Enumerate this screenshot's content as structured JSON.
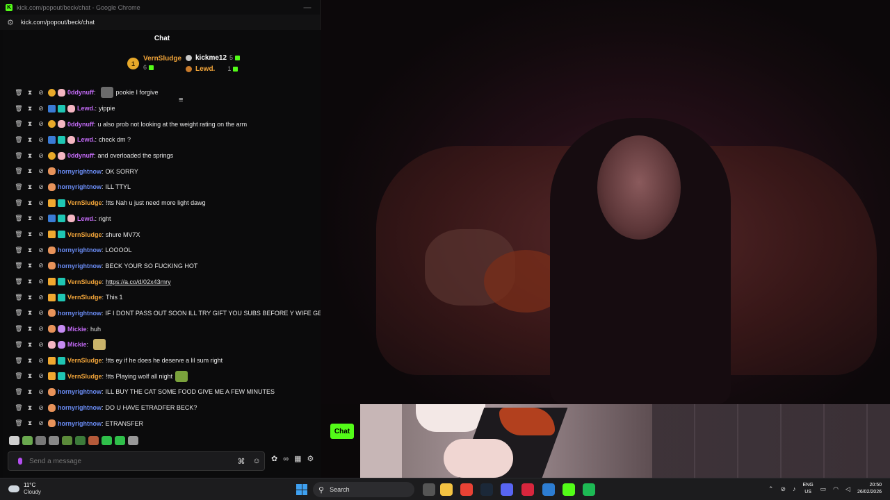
{
  "window": {
    "title": "kick.com/popout/beck/chat - Google Chrome",
    "url": "kick.com/popout/beck/chat",
    "favicon_letter": "K"
  },
  "chat": {
    "header": "Chat",
    "leaderboard": {
      "first": {
        "rank": "1",
        "name": "VernSludge",
        "count": "6"
      },
      "second": {
        "name": "kickme12",
        "count": "5"
      },
      "third": {
        "name": "Lewd.",
        "count": "1"
      }
    },
    "messages": [
      {
        "user": "0ddynuff",
        "color": "#c26af5",
        "badges": [
          "b-coin",
          "b-pig"
        ],
        "text": "pookie I forgive",
        "emote_before": "emote",
        "link": false
      },
      {
        "user": "Lewd.",
        "color": "#c26af5",
        "badges": [
          "b-blue",
          "b-teal",
          "b-pig"
        ],
        "text": "yippie",
        "link": false
      },
      {
        "user": "0ddynuff",
        "color": "#c26af5",
        "badges": [
          "b-coin",
          "b-pig"
        ],
        "text": "u also prob not looking at the weight rating on the arm",
        "link": false
      },
      {
        "user": "Lewd.",
        "color": "#c26af5",
        "badges": [
          "b-blue",
          "b-teal",
          "b-pig"
        ],
        "text": "check dm ?",
        "link": false
      },
      {
        "user": "0ddynuff",
        "color": "#c26af5",
        "badges": [
          "b-coin",
          "b-pig"
        ],
        "text": "and overloaded the springs",
        "link": false
      },
      {
        "user": "hornyrightnow",
        "color": "#6a8cf5",
        "badges": [
          "b-bear"
        ],
        "text": "OK SORRY",
        "link": false
      },
      {
        "user": "hornyrightnow",
        "color": "#6a8cf5",
        "badges": [
          "b-bear"
        ],
        "text": "ILL TTYL",
        "link": false
      },
      {
        "user": "VernSludge",
        "color": "#f2a53a",
        "badges": [
          "b-crown",
          "b-teal"
        ],
        "text": "!tts Nah u just need more light dawg",
        "link": false
      },
      {
        "user": "Lewd.",
        "color": "#c26af5",
        "badges": [
          "b-blue",
          "b-teal",
          "b-pig"
        ],
        "text": "right",
        "link": false
      },
      {
        "user": "VernSludge",
        "color": "#f2a53a",
        "badges": [
          "b-crown",
          "b-teal"
        ],
        "text": "shure MV7X",
        "link": false
      },
      {
        "user": "hornyrightnow",
        "color": "#6a8cf5",
        "badges": [
          "b-bear"
        ],
        "text": "LOOOOL",
        "link": false
      },
      {
        "user": "hornyrightnow",
        "color": "#6a8cf5",
        "badges": [
          "b-bear"
        ],
        "text": "BECK YOUR SO FUCKING HOT",
        "link": false
      },
      {
        "user": "VernSludge",
        "color": "#f2a53a",
        "badges": [
          "b-crown",
          "b-teal"
        ],
        "text": "https://a.co/d/02x43mry",
        "link": true
      },
      {
        "user": "VernSludge",
        "color": "#f2a53a",
        "badges": [
          "b-crown",
          "b-teal"
        ],
        "text": "This 1",
        "link": false
      },
      {
        "user": "hornyrightnow",
        "color": "#6a8cf5",
        "badges": [
          "b-bear"
        ],
        "text": "IF I DONT PASS OUT SOON ILL TRY GIFT YOU SUBS BEFORE Y WIFE GETS H",
        "link": false
      },
      {
        "user": "Mickie",
        "color": "#c26af5",
        "badges": [
          "b-bear",
          "b-purple"
        ],
        "text": "huh",
        "link": false
      },
      {
        "user": "Mickie",
        "color": "#c26af5",
        "badges": [
          "b-pig",
          "b-purple"
        ],
        "text": "",
        "emote_after": "emote cat",
        "link": false
      },
      {
        "user": "VernSludge",
        "color": "#f2a53a",
        "badges": [
          "b-crown",
          "b-teal"
        ],
        "text": "!tts ey if he does he deserve a lil sum right",
        "link": false
      },
      {
        "user": "VernSludge",
        "color": "#f2a53a",
        "badges": [
          "b-crown",
          "b-teal"
        ],
        "text": "!tts Playing wolf all night",
        "emote_after": "emote frog",
        "link": false
      },
      {
        "user": "hornyrightnow",
        "color": "#6a8cf5",
        "badges": [
          "b-bear"
        ],
        "text": "ILL BUY THE CAT SOME FOOD GIVE ME A FEW MINUTES",
        "link": false
      },
      {
        "user": "hornyrightnow",
        "color": "#6a8cf5",
        "badges": [
          "b-bear"
        ],
        "text": "DO U HAVE ETRADFER BECK?",
        "link": false
      },
      {
        "user": "hornyrightnow",
        "color": "#6a8cf5",
        "badges": [
          "b-bear"
        ],
        "text": "ETRANSFER",
        "link": false
      }
    ],
    "input_placeholder": "Send a message",
    "send_label": "Chat"
  },
  "taskbar": {
    "weather_temp": "11°C",
    "weather_desc": "Cloudy",
    "search_label": "Search",
    "lang": "ENG",
    "region": "US",
    "time": "20:50",
    "date": "26/02/2026",
    "apps": [
      {
        "name": "file-explorer-icon",
        "color": "#f4c342"
      },
      {
        "name": "chrome-icon",
        "color": "#e94235"
      },
      {
        "name": "steam-icon",
        "color": "#1b2838"
      },
      {
        "name": "discord-icon",
        "color": "#5865f2"
      },
      {
        "name": "red-app-icon",
        "color": "#d7263d"
      },
      {
        "name": "blue-app-icon",
        "color": "#2d7dd2"
      },
      {
        "name": "kick-icon",
        "color": "#53fc18"
      },
      {
        "name": "spotify-icon",
        "color": "#1db954"
      }
    ]
  }
}
